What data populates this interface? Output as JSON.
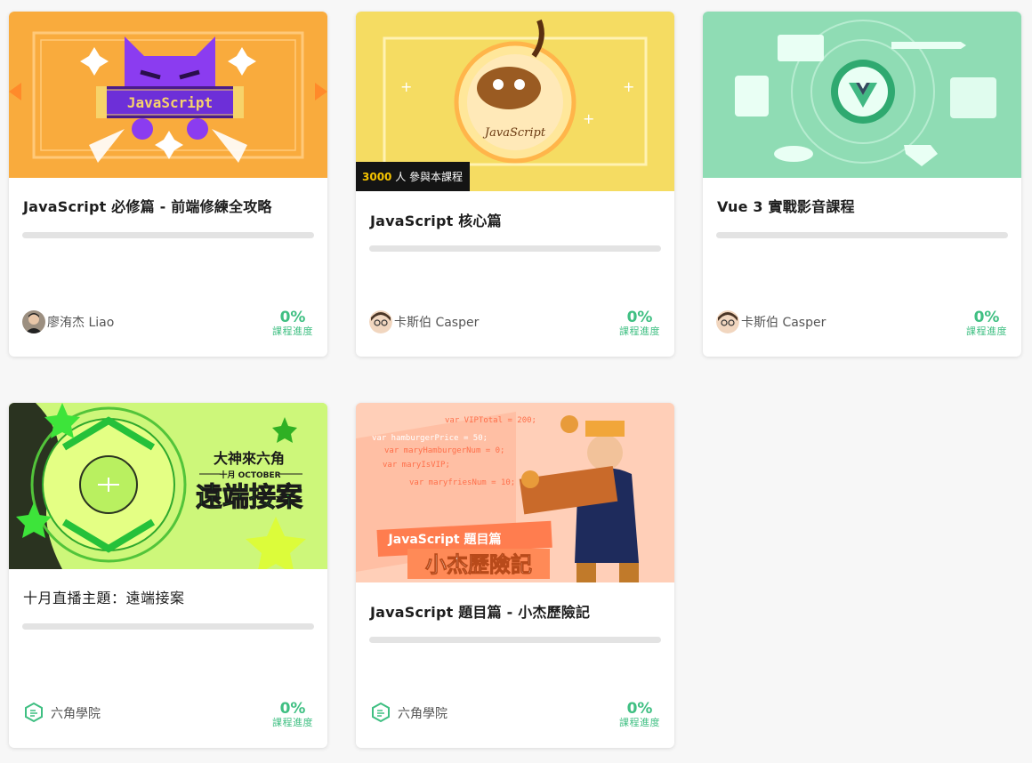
{
  "courses": [
    {
      "title": "JavaScript 必修篇 - 前端修練全攻略",
      "thumb_text": "JavaScript",
      "author": "廖洧杰 Liao",
      "progress_value": "0%",
      "progress_label": "課程進度",
      "progress_fraction": 0
    },
    {
      "title": "JavaScript 核心篇",
      "thumb_text": "JavaScript",
      "badge_count": "3000",
      "badge_text": "人 參與本課程",
      "author": "卡斯伯 Casper",
      "progress_value": "0%",
      "progress_label": "課程進度",
      "progress_fraction": 0
    },
    {
      "title": "Vue 3 實戰影音課程",
      "author": "卡斯伯 Casper",
      "progress_value": "0%",
      "progress_label": "課程進度",
      "progress_fraction": 0
    },
    {
      "title": "十月直播主題：遠端接案",
      "thumb_line1": "大神來六角",
      "thumb_line2": "十月 OCTOBER",
      "thumb_line3": "遠端接案",
      "author": "六角學院",
      "progress_value": "0%",
      "progress_label": "課程進度",
      "progress_fraction": 0
    },
    {
      "title": "JavaScript 題目篇 - 小杰歷險記",
      "thumb_code": [
        "var VIPTotal = 200;",
        "var hamburgerPrice = 50;",
        "var maryHamburgerNum = 0;",
        "var maryIsVIP;",
        "var maryfriesNum = 10;"
      ],
      "thumb_banner1": "JavaScript 題目篇",
      "thumb_banner2": "小杰歷險記",
      "author": "六角學院",
      "progress_value": "0%",
      "progress_label": "課程進度",
      "progress_fraction": 0
    }
  ],
  "colors": {
    "accent": "#3fbf82",
    "track": "#e3e3e3",
    "badge_bg": "#141414",
    "badge_number": "#f5c300"
  },
  "icons": [
    "liao-avatar",
    "casper-avatar",
    "hexschool-logo-icon"
  ]
}
